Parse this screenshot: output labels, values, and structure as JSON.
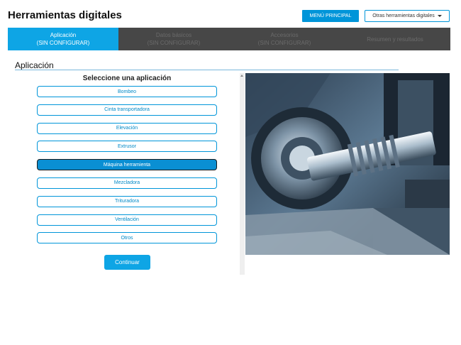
{
  "header": {
    "title": "Herramientas digitales",
    "main_menu_label": "MENÚ PRINCIPAL",
    "other_tools_label": "Otras herramientas digitales"
  },
  "steps": [
    {
      "name": "Aplicación",
      "status": "(SIN CONFIGURAR)",
      "active": true
    },
    {
      "name": "Datos básicos",
      "status": "(SIN CONFIGURAR)",
      "active": false
    },
    {
      "name": "Accesorios",
      "status": "(SIN CONFIGURAR)",
      "active": false
    },
    {
      "name": "Resumen y resultados",
      "status": "",
      "active": false
    }
  ],
  "section": {
    "title": "Aplicación"
  },
  "panel": {
    "heading": "Seleccione una aplicación"
  },
  "options": [
    {
      "label": "Bombeo",
      "selected": false
    },
    {
      "label": "Cinta transportadora",
      "selected": false
    },
    {
      "label": "Elevación",
      "selected": false
    },
    {
      "label": "Extrusor",
      "selected": false
    },
    {
      "label": "Máquina herramienta",
      "selected": true
    },
    {
      "label": "Mezcladora",
      "selected": false
    },
    {
      "label": "Trituradora",
      "selected": false
    },
    {
      "label": "Ventilación",
      "selected": false
    },
    {
      "label": "Otros",
      "selected": false
    }
  ],
  "continue_label": "Continuar",
  "colors": {
    "accent": "#0ea5e5",
    "step_bar": "#474747",
    "selected_option": "#0a8fd3"
  },
  "icons": {
    "dropdown": "caret-down-icon",
    "scroll": "scroll-up-icon"
  }
}
